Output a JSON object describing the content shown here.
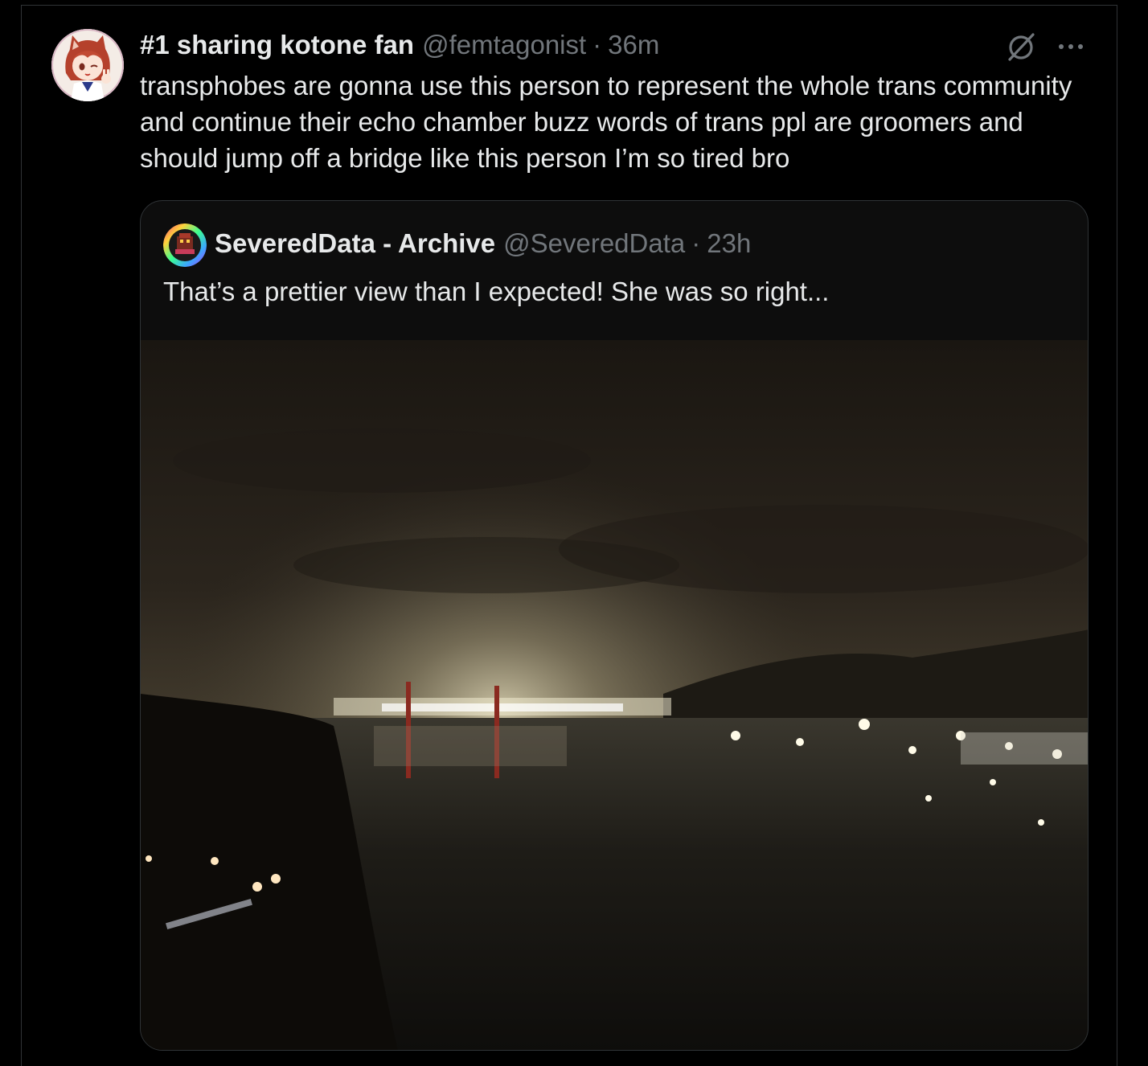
{
  "tweet": {
    "display_name": "#1 sharing kotone fan",
    "handle": "@femtagonist",
    "separator": "·",
    "time": "36m",
    "text": "transphobes are gonna use this person to represent the whole trans community and continue their echo chamber buzz words of trans ppl are groomers and should jump off a bridge like this person I’m so tired bro",
    "avatar_icon": "anime-avatar",
    "grok_icon": "grok-icon",
    "more_icon": "more-horizontal-icon"
  },
  "quoted_tweet": {
    "display_name": "SeveredData - Archive",
    "handle": "@SeveredData",
    "separator": "·",
    "time": "23h",
    "text": "That’s a prettier view than I expected! She was so right...",
    "avatar_icon": "rainbow-ring-avatar",
    "image_description_icon": "night-river-photo"
  },
  "colors": {
    "background": "#000000",
    "text_primary": "#e7e9ea",
    "text_secondary": "#71767b",
    "border": "#2f3336"
  }
}
